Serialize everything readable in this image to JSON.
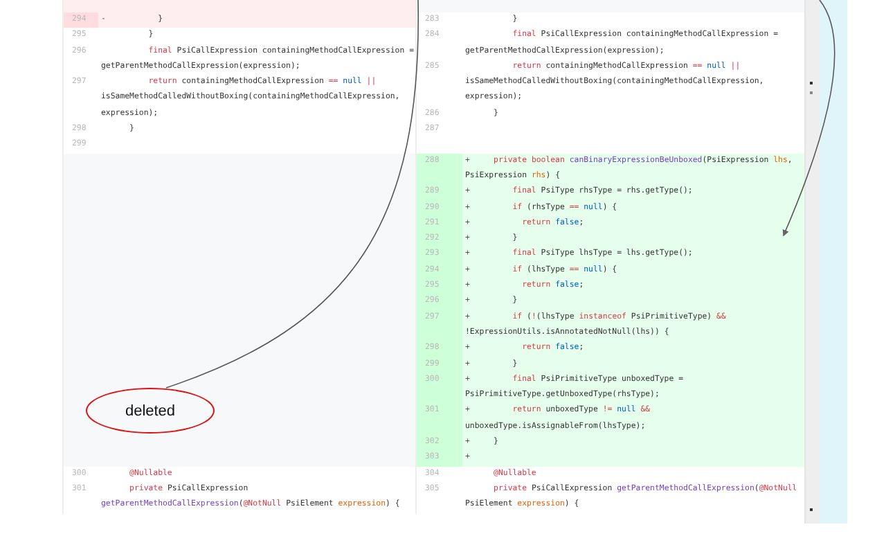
{
  "diff": {
    "blocks": [
      {
        "left": {
          "kind": "filler-deleted"
        },
        "right": {
          "kind": "filler-none"
        }
      },
      {
        "left": {
          "kind": "lines",
          "lines": [
            {
              "num": "294",
              "kind": "deleted",
              "marker": "-",
              "code": [
                {
                  "t": "          }"
                }
              ]
            },
            {
              "num": "295",
              "kind": "context",
              "code": [
                {
                  "t": "        }"
                }
              ]
            },
            {
              "num": "296",
              "kind": "context",
              "code": [
                {
                  "t": "        final",
                  "kind": "kw"
                },
                {
                  "t": " PsiCallExpression containingMethodCallExpression = getParentMethodCallExpression(expression);"
                }
              ]
            },
            {
              "num": "297",
              "kind": "context",
              "code": [
                {
                  "t": "        return",
                  "kind": "kw"
                },
                {
                  "t": " containingMethodCallExpression "
                },
                {
                  "t": "==",
                  "kind": "kw"
                },
                {
                  "t": " null",
                  "kind": "lit"
                },
                {
                  "t": " ||",
                  "kind": "kw"
                },
                {
                  "t": " isSameMethodCalledWithoutBoxing(containingMethodCallExpression, expression);"
                }
              ]
            },
            {
              "num": "298",
              "kind": "context",
              "code": [
                {
                  "t": "    }"
                }
              ]
            },
            {
              "num": "299",
              "kind": "context"
            }
          ]
        },
        "right": {
          "kind": "lines",
          "lines": [
            {
              "num": "283",
              "kind": "context",
              "code": [
                {
                  "t": "        }"
                }
              ]
            },
            {
              "num": "284",
              "kind": "context",
              "code": [
                {
                  "t": "        final",
                  "kind": "kw"
                },
                {
                  "t": " PsiCallExpression containingMethodCallExpression = getParentMethodCallExpression(expression);"
                }
              ]
            },
            {
              "num": "285",
              "kind": "context",
              "code": [
                {
                  "t": "        return",
                  "kind": "kw"
                },
                {
                  "t": " containingMethodCallExpression "
                },
                {
                  "t": "==",
                  "kind": "kw"
                },
                {
                  "t": " null",
                  "kind": "lit"
                },
                {
                  "t": " ||",
                  "kind": "kw"
                },
                {
                  "t": " isSameMethodCalledWithoutBoxing(containingMethodCallExpression, expression);"
                }
              ]
            },
            {
              "num": "286",
              "kind": "context",
              "code": [
                {
                  "t": "    }"
                }
              ]
            },
            {
              "num": "287",
              "kind": "context"
            }
          ]
        }
      },
      {
        "left": {
          "kind": "empty"
        },
        "right": {
          "kind": "lines",
          "lines": [
            {
              "num": "288",
              "kind": "added",
              "marker": "+",
              "code": [
                {
                  "t": "    private",
                  "kind": "kw"
                },
                {
                  "t": " boolean",
                  "kind": "kw"
                },
                {
                  "t": " canBinaryExpressionBeUnboxed",
                  "kind": "fn"
                },
                {
                  "t": "(PsiExpression "
                },
                {
                  "t": "lhs",
                  "kind": "param"
                },
                {
                  "t": ", PsiExpression "
                },
                {
                  "t": "rhs",
                  "kind": "param"
                },
                {
                  "t": ") {"
                }
              ]
            },
            {
              "num": "289",
              "kind": "added",
              "marker": "+",
              "code": [
                {
                  "t": "        final",
                  "kind": "kw"
                },
                {
                  "t": " PsiType rhsType = rhs.getType();"
                }
              ]
            },
            {
              "num": "290",
              "kind": "added",
              "marker": "+",
              "code": [
                {
                  "t": "        if",
                  "kind": "kw"
                },
                {
                  "t": " (rhsType "
                },
                {
                  "t": "==",
                  "kind": "kw"
                },
                {
                  "t": " null",
                  "kind": "lit"
                },
                {
                  "t": ") {"
                }
              ]
            },
            {
              "num": "291",
              "kind": "added",
              "marker": "+",
              "code": [
                {
                  "t": "          return",
                  "kind": "kw"
                },
                {
                  "t": " false",
                  "kind": "lit"
                },
                {
                  "t": ";"
                }
              ]
            },
            {
              "num": "292",
              "kind": "added",
              "marker": "+",
              "code": [
                {
                  "t": "        }"
                }
              ]
            },
            {
              "num": "293",
              "kind": "added",
              "marker": "+",
              "code": [
                {
                  "t": "        final",
                  "kind": "kw"
                },
                {
                  "t": " PsiType lhsType = lhs.getType();"
                }
              ]
            },
            {
              "num": "294",
              "kind": "added",
              "marker": "+",
              "code": [
                {
                  "t": "        if",
                  "kind": "kw"
                },
                {
                  "t": " (lhsType "
                },
                {
                  "t": "==",
                  "kind": "kw"
                },
                {
                  "t": " null",
                  "kind": "lit"
                },
                {
                  "t": ") {"
                }
              ]
            },
            {
              "num": "295",
              "kind": "added",
              "marker": "+",
              "code": [
                {
                  "t": "          return",
                  "kind": "kw"
                },
                {
                  "t": " false",
                  "kind": "lit"
                },
                {
                  "t": ";"
                }
              ]
            },
            {
              "num": "296",
              "kind": "added",
              "marker": "+",
              "code": [
                {
                  "t": "        }"
                }
              ]
            },
            {
              "num": "297",
              "kind": "added",
              "marker": "+",
              "code": [
                {
                  "t": "        if",
                  "kind": "kw"
                },
                {
                  "t": " ("
                },
                {
                  "t": "!",
                  "kind": "kw"
                },
                {
                  "t": "(lhsType "
                },
                {
                  "t": "instanceof",
                  "kind": "kw"
                },
                {
                  "t": " PsiPrimitiveType) "
                },
                {
                  "t": "&&",
                  "kind": "kw"
                },
                {
                  "t": " !ExpressionUtils.isAnnotatedNotNull(lhs)) {"
                }
              ]
            },
            {
              "num": "298",
              "kind": "added",
              "marker": "+",
              "code": [
                {
                  "t": "          return",
                  "kind": "kw"
                },
                {
                  "t": " false",
                  "kind": "lit"
                },
                {
                  "t": ";"
                }
              ]
            },
            {
              "num": "299",
              "kind": "added",
              "marker": "+",
              "code": [
                {
                  "t": "        }"
                }
              ]
            },
            {
              "num": "300",
              "kind": "added",
              "marker": "+",
              "code": [
                {
                  "t": "        final",
                  "kind": "kw"
                },
                {
                  "t": " PsiPrimitiveType unboxedType = PsiPrimitiveType.getUnboxedType(rhsType);"
                }
              ]
            },
            {
              "num": "301",
              "kind": "added",
              "marker": "+",
              "code": [
                {
                  "t": "        return",
                  "kind": "kw"
                },
                {
                  "t": " unboxedType "
                },
                {
                  "t": "!=",
                  "kind": "kw"
                },
                {
                  "t": " null",
                  "kind": "lit"
                },
                {
                  "t": " &&",
                  "kind": "kw"
                },
                {
                  "t": " unboxedType.isAssignableFrom(lhsType);"
                }
              ]
            },
            {
              "num": "302",
              "kind": "added",
              "marker": "+",
              "code": [
                {
                  "t": "    }"
                }
              ]
            },
            {
              "num": "303",
              "kind": "added",
              "marker": "+"
            }
          ]
        }
      },
      {
        "left": {
          "kind": "lines",
          "lines": [
            {
              "num": "300",
              "kind": "context",
              "code": [
                {
                  "t": "    @Nullable",
                  "kind": "ann"
                }
              ]
            },
            {
              "num": "301",
              "kind": "context",
              "code": [
                {
                  "t": "    private",
                  "kind": "kw"
                },
                {
                  "t": " PsiCallExpression "
                },
                {
                  "t": "getParentMethodCallExpression",
                  "kind": "fn"
                },
                {
                  "t": "("
                },
                {
                  "t": "@NotNull",
                  "kind": "ann"
                },
                {
                  "t": " PsiElement "
                },
                {
                  "t": "expression",
                  "kind": "param"
                },
                {
                  "t": ") {"
                }
              ]
            }
          ]
        },
        "right": {
          "kind": "lines",
          "lines": [
            {
              "num": "304",
              "kind": "context",
              "code": [
                {
                  "t": "    @Nullable",
                  "kind": "ann"
                }
              ]
            },
            {
              "num": "305",
              "kind": "context",
              "code": [
                {
                  "t": "    private",
                  "kind": "kw"
                },
                {
                  "t": " PsiCallExpression "
                },
                {
                  "t": "getParentMethodCallExpression",
                  "kind": "fn"
                },
                {
                  "t": "("
                },
                {
                  "t": "@NotNull",
                  "kind": "ann"
                },
                {
                  "t": " PsiElement "
                },
                {
                  "t": "expression",
                  "kind": "param"
                },
                {
                  "t": ") {"
                }
              ]
            }
          ]
        }
      }
    ]
  },
  "annotations": [
    {
      "kind": "callout",
      "text": "deleted"
    },
    {
      "kind": "arrow"
    }
  ]
}
